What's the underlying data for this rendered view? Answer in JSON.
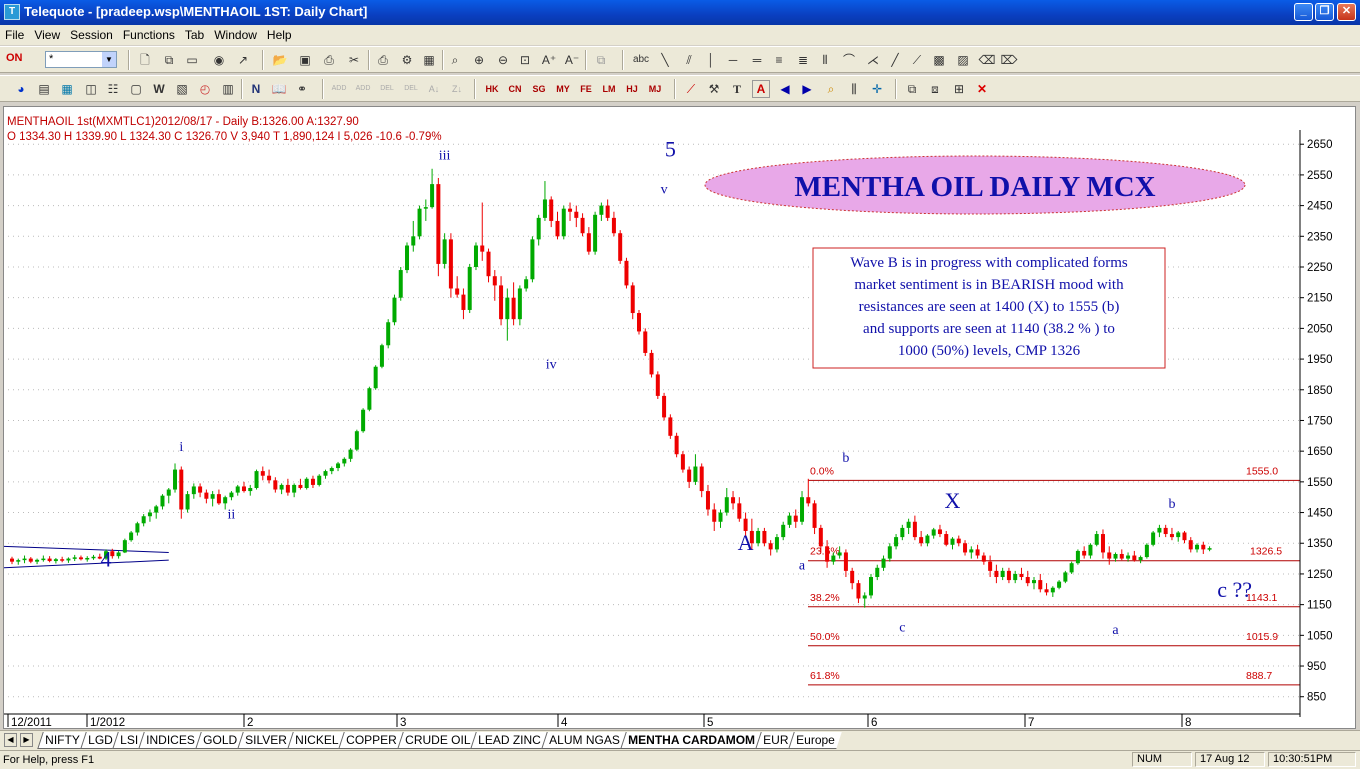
{
  "window": {
    "title": "Telequote - [pradeep.wsp\\MENTHAOIL 1ST: Daily Chart]",
    "min_label": "_",
    "restore_label": "❐",
    "close_label": "✕"
  },
  "menu": [
    "File",
    "View",
    "Session",
    "Functions",
    "Tab",
    "Window",
    "Help"
  ],
  "toolbar": {
    "on_label": "ON",
    "symbol_value": "*"
  },
  "tb2_groups": {
    "exchanges": [
      "HK",
      "CN",
      "SG",
      "MY",
      "FE",
      "LM",
      "HJ",
      "MJ"
    ]
  },
  "chart_data": {
    "type": "candlestick",
    "header_line1": "MENTHAOIL 1st(MXMTLC1)2012/08/17  - Daily B:1326.00 A:1327.90",
    "header_line2": "O 1334.30 H 1339.90 L 1324.30 C 1326.70 V 3,940 T 1,890,124 I 5,026  -10.6  -0.79%",
    "ohlc": {
      "open": 1334.3,
      "high": 1339.9,
      "low": 1324.3,
      "close": 1326.7
    },
    "ylim": [
      810,
      2680
    ],
    "y_ticks": [
      2650,
      2550,
      2450,
      2350,
      2250,
      2150,
      2050,
      1950,
      1850,
      1750,
      1650,
      1550,
      1450,
      1350,
      1250,
      1150,
      1050,
      950,
      850
    ],
    "x_labels": [
      "12/2011",
      "1/2012",
      "2",
      "3",
      "4",
      "5",
      "6",
      "7",
      "8"
    ],
    "last_price_label": "1326.5",
    "title_banner": "MENTHA  OIL  DAILY  MCX",
    "commentary": [
      "Wave B is in progress with complicated forms",
      "market sentiment is in  BEARISH mood with",
      "resistances are seen at 1400 (X) to 1555 (b)",
      "and supports are seen at 1140 (38.2 % ) to",
      "1000 (50%) levels, CMP 1326"
    ],
    "fibonacci": [
      {
        "label": "0.0%",
        "value": "1555.0",
        "price": 1555
      },
      {
        "label": "23.6%",
        "value": "",
        "price": 1293
      },
      {
        "label": "38.2%",
        "value": "1143.1",
        "price": 1143.1
      },
      {
        "label": "50.0%",
        "value": "1015.9",
        "price": 1015.9
      },
      {
        "label": "61.8%",
        "value": "888.7",
        "price": 888.7
      }
    ],
    "wave_labels": [
      {
        "text": "4",
        "size": "big",
        "day": 15,
        "price": 1275
      },
      {
        "text": "i",
        "size": "small",
        "day": 27,
        "price": 1650
      },
      {
        "text": "ii",
        "size": "small",
        "day": 35,
        "price": 1430
      },
      {
        "text": "iii",
        "size": "small",
        "day": 69,
        "price": 2600
      },
      {
        "text": "iv",
        "size": "small",
        "day": 86,
        "price": 1920
      },
      {
        "text": "5",
        "size": "big",
        "day": 105,
        "price": 2610
      },
      {
        "text": "v",
        "size": "small",
        "day": 104,
        "price": 2490
      },
      {
        "text": "A",
        "size": "big",
        "day": 117,
        "price": 1328
      },
      {
        "text": "a",
        "size": "small",
        "day": 126,
        "price": 1265
      },
      {
        "text": "b",
        "size": "small",
        "day": 133,
        "price": 1615
      },
      {
        "text": "c",
        "size": "small",
        "day": 142,
        "price": 1062
      },
      {
        "text": "X",
        "size": "big",
        "day": 150,
        "price": 1465
      },
      {
        "text": "a",
        "size": "small",
        "day": 176,
        "price": 1055
      },
      {
        "text": "b",
        "size": "small",
        "day": 185,
        "price": 1465
      },
      {
        "text": "c ??",
        "size": "big",
        "day": 195,
        "price": 1175
      }
    ],
    "trend_channel": {
      "start_day": 0,
      "end_day": 25,
      "upper": [
        1340,
        1320
      ],
      "lower": [
        1270,
        1295
      ]
    },
    "candles": [
      [
        1300,
        1306,
        1282,
        1290
      ],
      [
        1290,
        1300,
        1280,
        1295
      ],
      [
        1295,
        1310,
        1285,
        1300
      ],
      [
        1300,
        1305,
        1285,
        1290
      ],
      [
        1290,
        1300,
        1282,
        1296
      ],
      [
        1296,
        1310,
        1290,
        1300
      ],
      [
        1300,
        1308,
        1288,
        1292
      ],
      [
        1292,
        1302,
        1284,
        1298
      ],
      [
        1298,
        1306,
        1288,
        1294
      ],
      [
        1294,
        1304,
        1286,
        1300
      ],
      [
        1300,
        1312,
        1292,
        1304
      ],
      [
        1304,
        1310,
        1294,
        1298
      ],
      [
        1298,
        1308,
        1290,
        1302
      ],
      [
        1302,
        1312,
        1296,
        1306
      ],
      [
        1306,
        1316,
        1298,
        1300
      ],
      [
        1300,
        1330,
        1296,
        1324
      ],
      [
        1324,
        1332,
        1300,
        1308
      ],
      [
        1308,
        1325,
        1300,
        1320
      ],
      [
        1320,
        1365,
        1318,
        1360
      ],
      [
        1360,
        1390,
        1355,
        1385
      ],
      [
        1385,
        1420,
        1375,
        1415
      ],
      [
        1415,
        1445,
        1405,
        1438
      ],
      [
        1438,
        1460,
        1420,
        1450
      ],
      [
        1450,
        1475,
        1430,
        1470
      ],
      [
        1470,
        1510,
        1460,
        1505
      ],
      [
        1505,
        1530,
        1480,
        1525
      ],
      [
        1525,
        1610,
        1515,
        1590
      ],
      [
        1590,
        1600,
        1430,
        1460
      ],
      [
        1460,
        1520,
        1450,
        1510
      ],
      [
        1510,
        1545,
        1495,
        1535
      ],
      [
        1535,
        1545,
        1500,
        1515
      ],
      [
        1515,
        1525,
        1480,
        1495
      ],
      [
        1495,
        1520,
        1470,
        1510
      ],
      [
        1510,
        1525,
        1475,
        1480
      ],
      [
        1480,
        1505,
        1460,
        1500
      ],
      [
        1500,
        1520,
        1490,
        1515
      ],
      [
        1515,
        1540,
        1505,
        1535
      ],
      [
        1535,
        1550,
        1515,
        1520
      ],
      [
        1520,
        1540,
        1505,
        1530
      ],
      [
        1530,
        1590,
        1525,
        1585
      ],
      [
        1585,
        1600,
        1555,
        1570
      ],
      [
        1570,
        1590,
        1545,
        1555
      ],
      [
        1555,
        1565,
        1515,
        1525
      ],
      [
        1525,
        1545,
        1510,
        1540
      ],
      [
        1540,
        1560,
        1505,
        1515
      ],
      [
        1515,
        1545,
        1500,
        1540
      ],
      [
        1540,
        1560,
        1525,
        1530
      ],
      [
        1530,
        1565,
        1525,
        1560
      ],
      [
        1560,
        1570,
        1530,
        1540
      ],
      [
        1540,
        1575,
        1535,
        1570
      ],
      [
        1570,
        1590,
        1560,
        1585
      ],
      [
        1585,
        1600,
        1575,
        1595
      ],
      [
        1595,
        1615,
        1585,
        1610
      ],
      [
        1610,
        1630,
        1600,
        1625
      ],
      [
        1625,
        1660,
        1615,
        1655
      ],
      [
        1655,
        1720,
        1650,
        1715
      ],
      [
        1715,
        1790,
        1710,
        1785
      ],
      [
        1785,
        1860,
        1780,
        1855
      ],
      [
        1855,
        1930,
        1850,
        1925
      ],
      [
        1925,
        2000,
        1920,
        1995
      ],
      [
        1995,
        2080,
        1985,
        2070
      ],
      [
        2070,
        2160,
        2060,
        2150
      ],
      [
        2150,
        2250,
        2140,
        2240
      ],
      [
        2240,
        2330,
        2230,
        2320
      ],
      [
        2320,
        2400,
        2300,
        2350
      ],
      [
        2350,
        2450,
        2340,
        2440
      ],
      [
        2440,
        2470,
        2400,
        2445
      ],
      [
        2445,
        2570,
        2440,
        2520
      ],
      [
        2520,
        2540,
        2220,
        2260
      ],
      [
        2260,
        2360,
        2245,
        2340
      ],
      [
        2340,
        2360,
        2150,
        2180
      ],
      [
        2180,
        2220,
        2150,
        2160
      ],
      [
        2160,
        2180,
        2080,
        2110
      ],
      [
        2110,
        2260,
        2100,
        2250
      ],
      [
        2250,
        2330,
        2240,
        2320
      ],
      [
        2320,
        2460,
        2270,
        2300
      ],
      [
        2300,
        2310,
        2200,
        2220
      ],
      [
        2220,
        2240,
        2140,
        2190
      ],
      [
        2190,
        2220,
        2060,
        2080
      ],
      [
        2080,
        2180,
        2010,
        2150
      ],
      [
        2150,
        2200,
        2060,
        2080
      ],
      [
        2080,
        2190,
        2060,
        2180
      ],
      [
        2180,
        2220,
        2170,
        2210
      ],
      [
        2210,
        2350,
        2200,
        2340
      ],
      [
        2340,
        2420,
        2320,
        2410
      ],
      [
        2410,
        2530,
        2400,
        2470
      ],
      [
        2470,
        2480,
        2380,
        2400
      ],
      [
        2400,
        2430,
        2340,
        2350
      ],
      [
        2350,
        2450,
        2340,
        2440
      ],
      [
        2440,
        2460,
        2400,
        2430
      ],
      [
        2430,
        2450,
        2380,
        2410
      ],
      [
        2410,
        2425,
        2350,
        2360
      ],
      [
        2360,
        2380,
        2290,
        2300
      ],
      [
        2300,
        2430,
        2290,
        2420
      ],
      [
        2420,
        2460,
        2400,
        2450
      ],
      [
        2450,
        2470,
        2400,
        2410
      ],
      [
        2410,
        2430,
        2350,
        2360
      ],
      [
        2360,
        2370,
        2260,
        2270
      ],
      [
        2270,
        2280,
        2180,
        2190
      ],
      [
        2190,
        2200,
        2080,
        2100
      ],
      [
        2100,
        2110,
        2030,
        2040
      ],
      [
        2040,
        2050,
        1960,
        1970
      ],
      [
        1970,
        1980,
        1890,
        1900
      ],
      [
        1900,
        1910,
        1820,
        1830
      ],
      [
        1830,
        1840,
        1750,
        1760
      ],
      [
        1760,
        1770,
        1690,
        1700
      ],
      [
        1700,
        1710,
        1630,
        1640
      ],
      [
        1640,
        1650,
        1580,
        1590
      ],
      [
        1590,
        1600,
        1530,
        1550
      ],
      [
        1550,
        1640,
        1540,
        1600
      ],
      [
        1600,
        1610,
        1500,
        1520
      ],
      [
        1520,
        1540,
        1440,
        1460
      ],
      [
        1460,
        1480,
        1390,
        1420
      ],
      [
        1420,
        1460,
        1400,
        1450
      ],
      [
        1450,
        1530,
        1440,
        1500
      ],
      [
        1500,
        1520,
        1460,
        1480
      ],
      [
        1480,
        1500,
        1420,
        1430
      ],
      [
        1430,
        1450,
        1370,
        1390
      ],
      [
        1390,
        1430,
        1330,
        1350
      ],
      [
        1350,
        1400,
        1340,
        1390
      ],
      [
        1390,
        1400,
        1340,
        1350
      ],
      [
        1350,
        1360,
        1310,
        1330
      ],
      [
        1330,
        1380,
        1320,
        1370
      ],
      [
        1370,
        1420,
        1360,
        1410
      ],
      [
        1410,
        1450,
        1400,
        1440
      ],
      [
        1440,
        1460,
        1400,
        1420
      ],
      [
        1420,
        1520,
        1410,
        1500
      ],
      [
        1500,
        1560,
        1470,
        1480
      ],
      [
        1480,
        1490,
        1380,
        1400
      ],
      [
        1400,
        1410,
        1320,
        1340
      ],
      [
        1340,
        1360,
        1270,
        1290
      ],
      [
        1290,
        1320,
        1280,
        1310
      ],
      [
        1310,
        1340,
        1300,
        1320
      ],
      [
        1320,
        1330,
        1240,
        1260
      ],
      [
        1260,
        1270,
        1200,
        1220
      ],
      [
        1220,
        1230,
        1155,
        1170
      ],
      [
        1170,
        1190,
        1140,
        1180
      ],
      [
        1180,
        1250,
        1170,
        1240
      ],
      [
        1240,
        1280,
        1230,
        1270
      ],
      [
        1270,
        1310,
        1260,
        1300
      ],
      [
        1300,
        1350,
        1290,
        1340
      ],
      [
        1340,
        1380,
        1330,
        1370
      ],
      [
        1370,
        1410,
        1360,
        1400
      ],
      [
        1400,
        1430,
        1380,
        1420
      ],
      [
        1420,
        1440,
        1360,
        1370
      ],
      [
        1370,
        1390,
        1340,
        1350
      ],
      [
        1350,
        1380,
        1340,
        1375
      ],
      [
        1375,
        1400,
        1365,
        1395
      ],
      [
        1395,
        1410,
        1370,
        1380
      ],
      [
        1380,
        1390,
        1340,
        1345
      ],
      [
        1345,
        1370,
        1330,
        1365
      ],
      [
        1365,
        1375,
        1340,
        1350
      ],
      [
        1350,
        1360,
        1310,
        1320
      ],
      [
        1320,
        1340,
        1300,
        1330
      ],
      [
        1330,
        1345,
        1300,
        1310
      ],
      [
        1310,
        1320,
        1280,
        1290
      ],
      [
        1290,
        1310,
        1240,
        1260
      ],
      [
        1260,
        1280,
        1220,
        1240
      ],
      [
        1240,
        1270,
        1230,
        1260
      ],
      [
        1260,
        1270,
        1220,
        1230
      ],
      [
        1230,
        1260,
        1220,
        1250
      ],
      [
        1250,
        1270,
        1230,
        1240
      ],
      [
        1240,
        1260,
        1210,
        1220
      ],
      [
        1220,
        1240,
        1200,
        1230
      ],
      [
        1230,
        1250,
        1190,
        1200
      ],
      [
        1200,
        1220,
        1180,
        1190
      ],
      [
        1190,
        1210,
        1175,
        1205
      ],
      [
        1205,
        1230,
        1200,
        1225
      ],
      [
        1225,
        1260,
        1220,
        1255
      ],
      [
        1255,
        1290,
        1250,
        1285
      ],
      [
        1285,
        1330,
        1280,
        1325
      ],
      [
        1325,
        1340,
        1300,
        1310
      ],
      [
        1310,
        1350,
        1300,
        1345
      ],
      [
        1345,
        1390,
        1340,
        1380
      ],
      [
        1380,
        1395,
        1300,
        1320
      ],
      [
        1320,
        1340,
        1280,
        1300
      ],
      [
        1300,
        1320,
        1290,
        1315
      ],
      [
        1315,
        1330,
        1295,
        1300
      ],
      [
        1300,
        1320,
        1290,
        1310
      ],
      [
        1310,
        1325,
        1290,
        1295
      ],
      [
        1295,
        1310,
        1285,
        1305
      ],
      [
        1305,
        1350,
        1300,
        1345
      ],
      [
        1345,
        1390,
        1340,
        1385
      ],
      [
        1385,
        1410,
        1370,
        1400
      ],
      [
        1400,
        1410,
        1370,
        1380
      ],
      [
        1380,
        1400,
        1360,
        1370
      ],
      [
        1370,
        1390,
        1355,
        1385
      ],
      [
        1385,
        1390,
        1350,
        1360
      ],
      [
        1360,
        1370,
        1320,
        1330
      ],
      [
        1330,
        1350,
        1320,
        1345
      ],
      [
        1345,
        1355,
        1315,
        1330
      ],
      [
        1330,
        1340,
        1324,
        1334
      ]
    ]
  },
  "sheet_tabs": [
    "NIFTY",
    "LGD",
    "LSI",
    "INDICES",
    "GOLD",
    "SILVER",
    "NICKEL",
    "COPPER",
    "CRUDE OIL",
    "LEAD ZINC",
    "ALUM NGAS",
    "MENTHA CARDAMOM",
    "EUR",
    "Europe"
  ],
  "active_tab": "MENTHA CARDAMOM",
  "status": {
    "help": "For Help, press F1",
    "num": "NUM",
    "date": "17 Aug 12",
    "time": "10:30:51PM"
  }
}
